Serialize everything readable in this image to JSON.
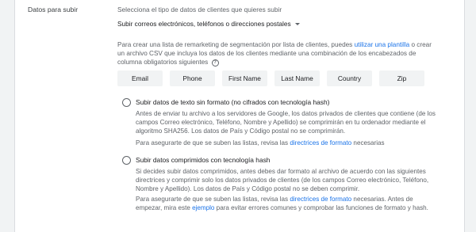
{
  "section": {
    "label": "Datos para subir",
    "intro": "Selecciona el tipo de datos de clientes que quieres subir",
    "dropdown_value": "Subir correos electrónicos, teléfonos o direcciones postales"
  },
  "description": {
    "text_before_link": "Para crear una lista de remarketing de segmentación por lista de clientes, puedes ",
    "link": "utilizar una plantilla",
    "text_after_link": " o crear un archivo CSV que incluya los datos de los clientes mediante una combinación de los encabezados de columna obligatorios siguientes",
    "help_icon": "?"
  },
  "headers": [
    "Email",
    "Phone",
    "First Name",
    "Last Name",
    "Country",
    "Zip"
  ],
  "options": [
    {
      "title": "Subir datos de texto sin formato (no cifrados con tecnología hash)",
      "body": "Antes de enviar tu archivo a los servidores de Google, los datos privados de clientes que contiene (de los campos Correo electrónico, Teléfono, Nombre y Apellido) se comprimirán en tu ordenador mediante el algoritmo SHA256. Los datos de País y Código postal no se comprimirán.",
      "note_before": "Para asegurarte de que se suben las listas, revisa las ",
      "note_link": "directrices de formato",
      "note_after": " necesarias"
    },
    {
      "title": "Subir datos comprimidos con tecnología hash",
      "body": "Si decides subir datos comprimidos, antes debes dar formato al archivo de acuerdo con las siguientes directrices y comprimir solo los datos privados de clientes (de los campos Correo electrónico, Teléfono, Nombre y Apellido). Los datos de País y Código postal no se deben comprimir.",
      "note_before": "Para asegurarte de que se suben las listas, revisa las ",
      "note_link": "directrices de formato",
      "note_middle": " necesarias. Antes de empezar, mira este ",
      "note_link2": "ejemplo",
      "note_after": " para evitar errores comunes y comprobar las funciones de formato y hash."
    }
  ]
}
